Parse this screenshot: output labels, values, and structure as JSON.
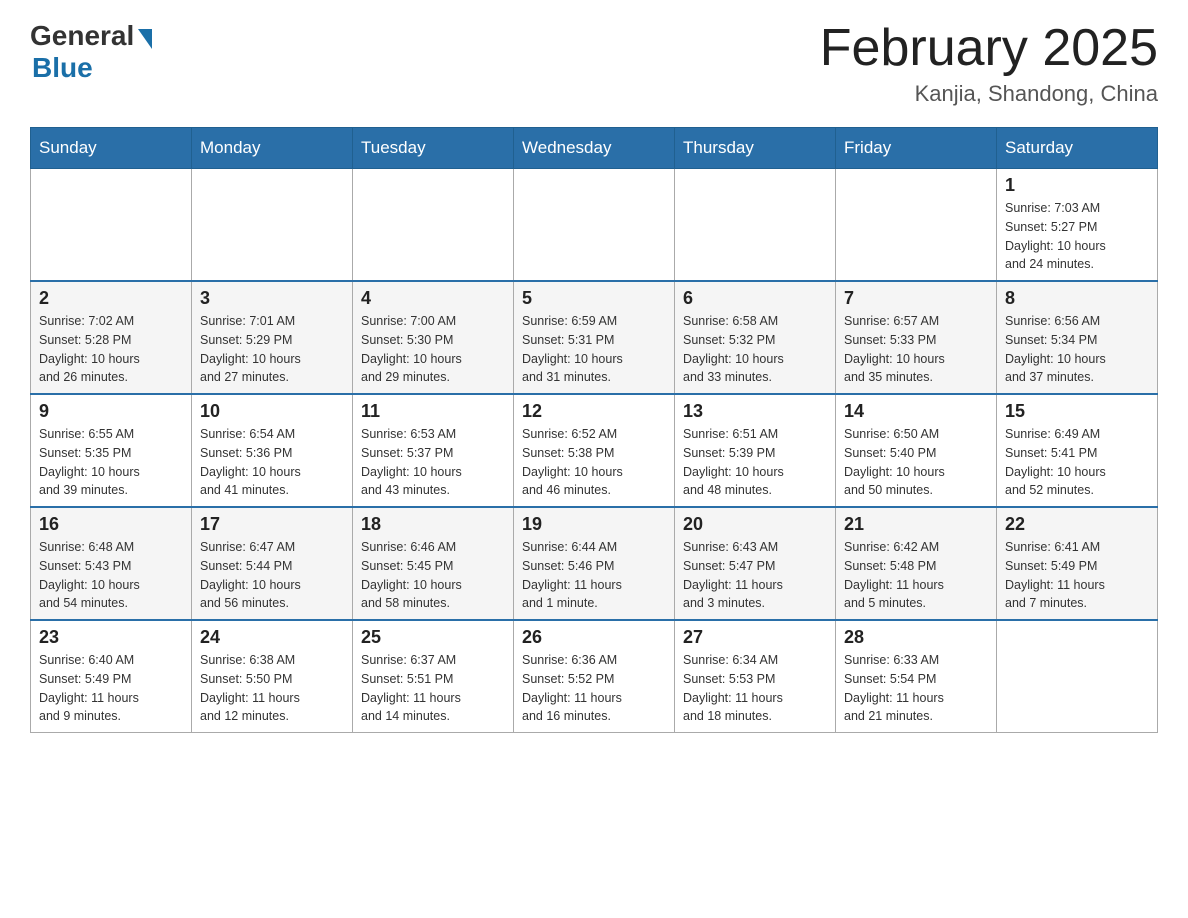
{
  "header": {
    "logo_general": "General",
    "logo_blue": "Blue",
    "title": "February 2025",
    "subtitle": "Kanjia, Shandong, China"
  },
  "weekdays": [
    "Sunday",
    "Monday",
    "Tuesday",
    "Wednesday",
    "Thursday",
    "Friday",
    "Saturday"
  ],
  "weeks": [
    {
      "days": [
        {
          "number": "",
          "info": ""
        },
        {
          "number": "",
          "info": ""
        },
        {
          "number": "",
          "info": ""
        },
        {
          "number": "",
          "info": ""
        },
        {
          "number": "",
          "info": ""
        },
        {
          "number": "",
          "info": ""
        },
        {
          "number": "1",
          "info": "Sunrise: 7:03 AM\nSunset: 5:27 PM\nDaylight: 10 hours\nand 24 minutes."
        }
      ]
    },
    {
      "days": [
        {
          "number": "2",
          "info": "Sunrise: 7:02 AM\nSunset: 5:28 PM\nDaylight: 10 hours\nand 26 minutes."
        },
        {
          "number": "3",
          "info": "Sunrise: 7:01 AM\nSunset: 5:29 PM\nDaylight: 10 hours\nand 27 minutes."
        },
        {
          "number": "4",
          "info": "Sunrise: 7:00 AM\nSunset: 5:30 PM\nDaylight: 10 hours\nand 29 minutes."
        },
        {
          "number": "5",
          "info": "Sunrise: 6:59 AM\nSunset: 5:31 PM\nDaylight: 10 hours\nand 31 minutes."
        },
        {
          "number": "6",
          "info": "Sunrise: 6:58 AM\nSunset: 5:32 PM\nDaylight: 10 hours\nand 33 minutes."
        },
        {
          "number": "7",
          "info": "Sunrise: 6:57 AM\nSunset: 5:33 PM\nDaylight: 10 hours\nand 35 minutes."
        },
        {
          "number": "8",
          "info": "Sunrise: 6:56 AM\nSunset: 5:34 PM\nDaylight: 10 hours\nand 37 minutes."
        }
      ]
    },
    {
      "days": [
        {
          "number": "9",
          "info": "Sunrise: 6:55 AM\nSunset: 5:35 PM\nDaylight: 10 hours\nand 39 minutes."
        },
        {
          "number": "10",
          "info": "Sunrise: 6:54 AM\nSunset: 5:36 PM\nDaylight: 10 hours\nand 41 minutes."
        },
        {
          "number": "11",
          "info": "Sunrise: 6:53 AM\nSunset: 5:37 PM\nDaylight: 10 hours\nand 43 minutes."
        },
        {
          "number": "12",
          "info": "Sunrise: 6:52 AM\nSunset: 5:38 PM\nDaylight: 10 hours\nand 46 minutes."
        },
        {
          "number": "13",
          "info": "Sunrise: 6:51 AM\nSunset: 5:39 PM\nDaylight: 10 hours\nand 48 minutes."
        },
        {
          "number": "14",
          "info": "Sunrise: 6:50 AM\nSunset: 5:40 PM\nDaylight: 10 hours\nand 50 minutes."
        },
        {
          "number": "15",
          "info": "Sunrise: 6:49 AM\nSunset: 5:41 PM\nDaylight: 10 hours\nand 52 minutes."
        }
      ]
    },
    {
      "days": [
        {
          "number": "16",
          "info": "Sunrise: 6:48 AM\nSunset: 5:43 PM\nDaylight: 10 hours\nand 54 minutes."
        },
        {
          "number": "17",
          "info": "Sunrise: 6:47 AM\nSunset: 5:44 PM\nDaylight: 10 hours\nand 56 minutes."
        },
        {
          "number": "18",
          "info": "Sunrise: 6:46 AM\nSunset: 5:45 PM\nDaylight: 10 hours\nand 58 minutes."
        },
        {
          "number": "19",
          "info": "Sunrise: 6:44 AM\nSunset: 5:46 PM\nDaylight: 11 hours\nand 1 minute."
        },
        {
          "number": "20",
          "info": "Sunrise: 6:43 AM\nSunset: 5:47 PM\nDaylight: 11 hours\nand 3 minutes."
        },
        {
          "number": "21",
          "info": "Sunrise: 6:42 AM\nSunset: 5:48 PM\nDaylight: 11 hours\nand 5 minutes."
        },
        {
          "number": "22",
          "info": "Sunrise: 6:41 AM\nSunset: 5:49 PM\nDaylight: 11 hours\nand 7 minutes."
        }
      ]
    },
    {
      "days": [
        {
          "number": "23",
          "info": "Sunrise: 6:40 AM\nSunset: 5:49 PM\nDaylight: 11 hours\nand 9 minutes."
        },
        {
          "number": "24",
          "info": "Sunrise: 6:38 AM\nSunset: 5:50 PM\nDaylight: 11 hours\nand 12 minutes."
        },
        {
          "number": "25",
          "info": "Sunrise: 6:37 AM\nSunset: 5:51 PM\nDaylight: 11 hours\nand 14 minutes."
        },
        {
          "number": "26",
          "info": "Sunrise: 6:36 AM\nSunset: 5:52 PM\nDaylight: 11 hours\nand 16 minutes."
        },
        {
          "number": "27",
          "info": "Sunrise: 6:34 AM\nSunset: 5:53 PM\nDaylight: 11 hours\nand 18 minutes."
        },
        {
          "number": "28",
          "info": "Sunrise: 6:33 AM\nSunset: 5:54 PM\nDaylight: 11 hours\nand 21 minutes."
        },
        {
          "number": "",
          "info": ""
        }
      ]
    }
  ]
}
